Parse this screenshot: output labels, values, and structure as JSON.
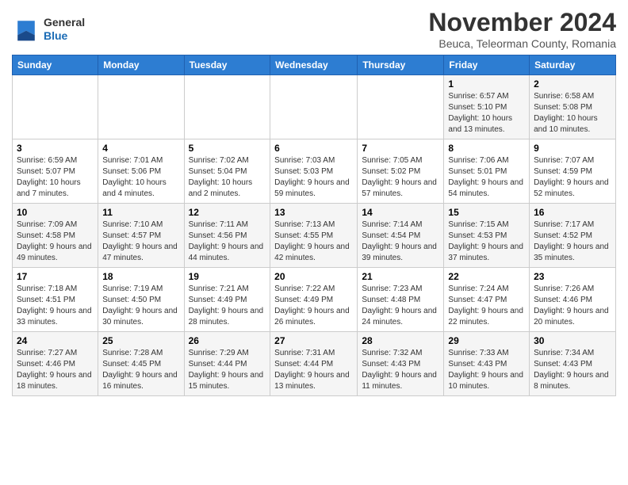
{
  "logo": {
    "line1": "General",
    "line2": "Blue"
  },
  "title": "November 2024",
  "subtitle": "Beuca, Teleorman County, Romania",
  "headers": [
    "Sunday",
    "Monday",
    "Tuesday",
    "Wednesday",
    "Thursday",
    "Friday",
    "Saturday"
  ],
  "weeks": [
    [
      {
        "day": "",
        "detail": ""
      },
      {
        "day": "",
        "detail": ""
      },
      {
        "day": "",
        "detail": ""
      },
      {
        "day": "",
        "detail": ""
      },
      {
        "day": "",
        "detail": ""
      },
      {
        "day": "1",
        "detail": "Sunrise: 6:57 AM\nSunset: 5:10 PM\nDaylight: 10 hours and 13 minutes."
      },
      {
        "day": "2",
        "detail": "Sunrise: 6:58 AM\nSunset: 5:08 PM\nDaylight: 10 hours and 10 minutes."
      }
    ],
    [
      {
        "day": "3",
        "detail": "Sunrise: 6:59 AM\nSunset: 5:07 PM\nDaylight: 10 hours and 7 minutes."
      },
      {
        "day": "4",
        "detail": "Sunrise: 7:01 AM\nSunset: 5:06 PM\nDaylight: 10 hours and 4 minutes."
      },
      {
        "day": "5",
        "detail": "Sunrise: 7:02 AM\nSunset: 5:04 PM\nDaylight: 10 hours and 2 minutes."
      },
      {
        "day": "6",
        "detail": "Sunrise: 7:03 AM\nSunset: 5:03 PM\nDaylight: 9 hours and 59 minutes."
      },
      {
        "day": "7",
        "detail": "Sunrise: 7:05 AM\nSunset: 5:02 PM\nDaylight: 9 hours and 57 minutes."
      },
      {
        "day": "8",
        "detail": "Sunrise: 7:06 AM\nSunset: 5:01 PM\nDaylight: 9 hours and 54 minutes."
      },
      {
        "day": "9",
        "detail": "Sunrise: 7:07 AM\nSunset: 4:59 PM\nDaylight: 9 hours and 52 minutes."
      }
    ],
    [
      {
        "day": "10",
        "detail": "Sunrise: 7:09 AM\nSunset: 4:58 PM\nDaylight: 9 hours and 49 minutes."
      },
      {
        "day": "11",
        "detail": "Sunrise: 7:10 AM\nSunset: 4:57 PM\nDaylight: 9 hours and 47 minutes."
      },
      {
        "day": "12",
        "detail": "Sunrise: 7:11 AM\nSunset: 4:56 PM\nDaylight: 9 hours and 44 minutes."
      },
      {
        "day": "13",
        "detail": "Sunrise: 7:13 AM\nSunset: 4:55 PM\nDaylight: 9 hours and 42 minutes."
      },
      {
        "day": "14",
        "detail": "Sunrise: 7:14 AM\nSunset: 4:54 PM\nDaylight: 9 hours and 39 minutes."
      },
      {
        "day": "15",
        "detail": "Sunrise: 7:15 AM\nSunset: 4:53 PM\nDaylight: 9 hours and 37 minutes."
      },
      {
        "day": "16",
        "detail": "Sunrise: 7:17 AM\nSunset: 4:52 PM\nDaylight: 9 hours and 35 minutes."
      }
    ],
    [
      {
        "day": "17",
        "detail": "Sunrise: 7:18 AM\nSunset: 4:51 PM\nDaylight: 9 hours and 33 minutes."
      },
      {
        "day": "18",
        "detail": "Sunrise: 7:19 AM\nSunset: 4:50 PM\nDaylight: 9 hours and 30 minutes."
      },
      {
        "day": "19",
        "detail": "Sunrise: 7:21 AM\nSunset: 4:49 PM\nDaylight: 9 hours and 28 minutes."
      },
      {
        "day": "20",
        "detail": "Sunrise: 7:22 AM\nSunset: 4:49 PM\nDaylight: 9 hours and 26 minutes."
      },
      {
        "day": "21",
        "detail": "Sunrise: 7:23 AM\nSunset: 4:48 PM\nDaylight: 9 hours and 24 minutes."
      },
      {
        "day": "22",
        "detail": "Sunrise: 7:24 AM\nSunset: 4:47 PM\nDaylight: 9 hours and 22 minutes."
      },
      {
        "day": "23",
        "detail": "Sunrise: 7:26 AM\nSunset: 4:46 PM\nDaylight: 9 hours and 20 minutes."
      }
    ],
    [
      {
        "day": "24",
        "detail": "Sunrise: 7:27 AM\nSunset: 4:46 PM\nDaylight: 9 hours and 18 minutes."
      },
      {
        "day": "25",
        "detail": "Sunrise: 7:28 AM\nSunset: 4:45 PM\nDaylight: 9 hours and 16 minutes."
      },
      {
        "day": "26",
        "detail": "Sunrise: 7:29 AM\nSunset: 4:44 PM\nDaylight: 9 hours and 15 minutes."
      },
      {
        "day": "27",
        "detail": "Sunrise: 7:31 AM\nSunset: 4:44 PM\nDaylight: 9 hours and 13 minutes."
      },
      {
        "day": "28",
        "detail": "Sunrise: 7:32 AM\nSunset: 4:43 PM\nDaylight: 9 hours and 11 minutes."
      },
      {
        "day": "29",
        "detail": "Sunrise: 7:33 AM\nSunset: 4:43 PM\nDaylight: 9 hours and 10 minutes."
      },
      {
        "day": "30",
        "detail": "Sunrise: 7:34 AM\nSunset: 4:43 PM\nDaylight: 9 hours and 8 minutes."
      }
    ]
  ]
}
